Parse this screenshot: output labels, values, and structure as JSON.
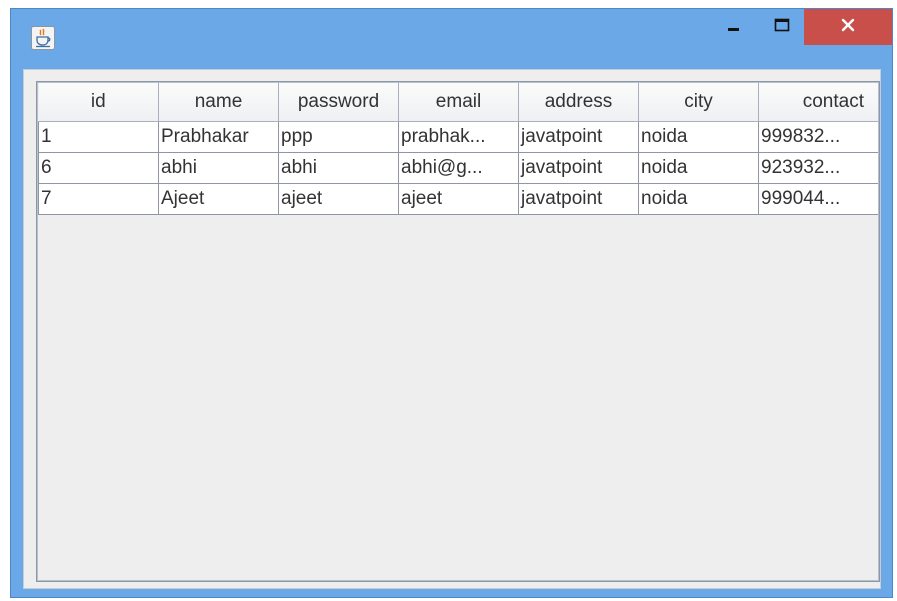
{
  "window": {
    "icon": "java-cup-icon",
    "controls": {
      "minimize_icon": "minimize-icon",
      "maximize_icon": "maximize-icon",
      "close_icon": "close-icon"
    },
    "colors": {
      "titlebar": "#6aa8e8",
      "close_button": "#c9504a",
      "client": "#eeeeee"
    }
  },
  "table": {
    "columns": [
      "id",
      "name",
      "password",
      "email",
      "address",
      "city",
      "contact"
    ],
    "rows": [
      [
        "1",
        "Prabhakar",
        "ppp",
        "prabhak...",
        "javatpoint",
        "noida",
        "999832..."
      ],
      [
        "6",
        "abhi",
        "abhi",
        "abhi@g...",
        "javatpoint",
        "noida",
        "923932..."
      ],
      [
        "7",
        "Ajeet",
        "ajeet",
        "ajeet",
        "javatpoint",
        "noida",
        "999044..."
      ]
    ]
  }
}
